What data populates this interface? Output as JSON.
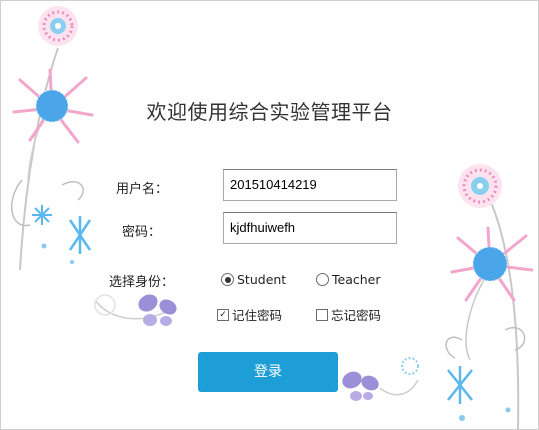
{
  "title": "欢迎使用综合实验管理平台",
  "form": {
    "username_label": "用户名：",
    "username_value": "201510414219",
    "password_label": "密码：",
    "password_value": "kjdfhuiwefh",
    "role_label": "选择身份：",
    "roles": [
      {
        "label": "Student",
        "selected": true
      },
      {
        "label": "Teacher",
        "selected": false
      }
    ],
    "remember": {
      "label": "记住密码",
      "checked": true
    },
    "forgot": {
      "label": "忘记密码",
      "checked": false
    },
    "login_label": "登录"
  },
  "colors": {
    "button": "#1e9ed6",
    "flower_blue": "#4aa6e8",
    "flower_pink": "#f08cc0",
    "butterfly": "#9b8fd8"
  }
}
